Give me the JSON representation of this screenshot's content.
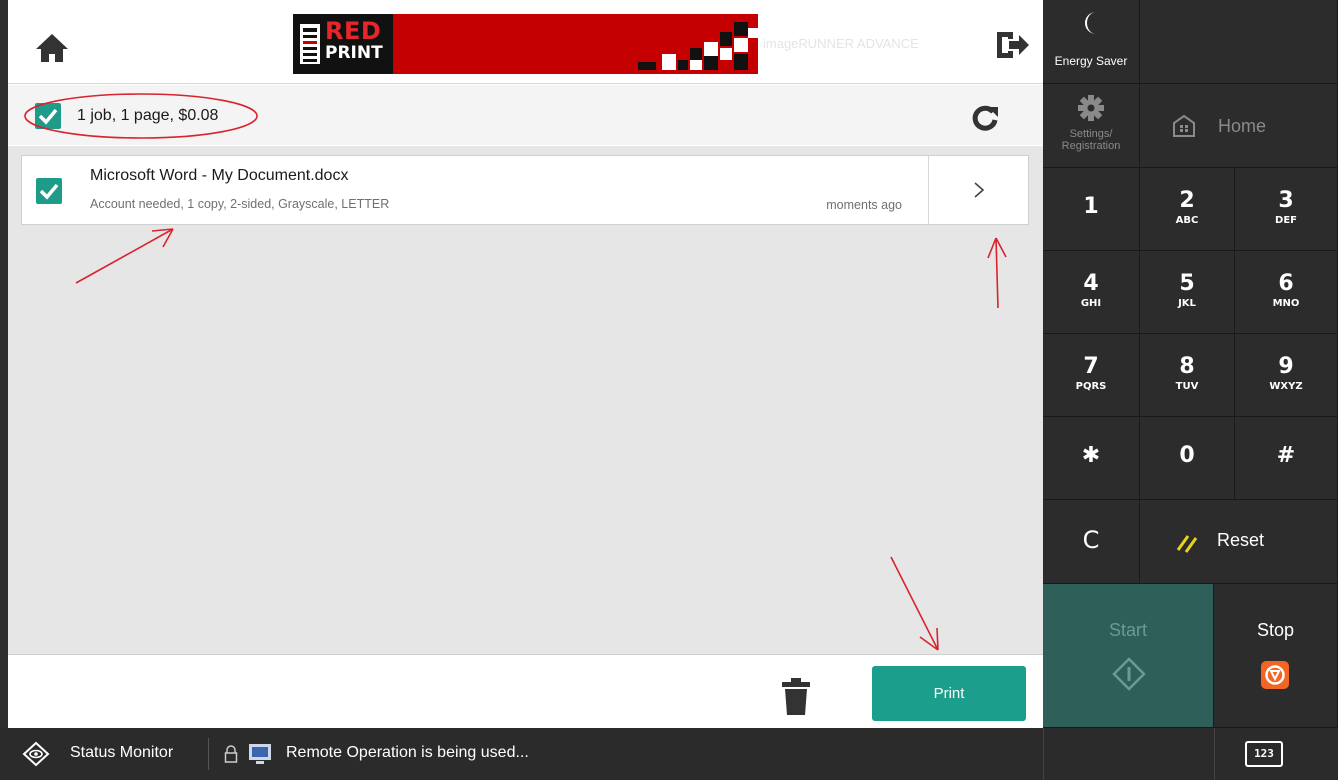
{
  "topbar": {
    "banner_red": "RED",
    "banner_print": "PRINT",
    "banner_faded": "imageRUNNER ADVANCE"
  },
  "summary": {
    "text": "1 job, 1 page, $0.08"
  },
  "job": {
    "title": "Microsoft Word - My Document.docx",
    "details": "Account needed, 1 copy, 2-sided, Grayscale, LETTER",
    "time": "moments ago"
  },
  "footer": {
    "print_label": "Print"
  },
  "statusbar": {
    "status_monitor": "Status Monitor",
    "remote": "Remote Operation is being used...",
    "keypad_toggle": "123"
  },
  "panel": {
    "energy_saver": "Energy Saver",
    "settings": "Settings/ Registration",
    "home": "Home",
    "keys": [
      {
        "num": "1",
        "sub": ""
      },
      {
        "num": "2",
        "sub": "ABC"
      },
      {
        "num": "3",
        "sub": "DEF"
      },
      {
        "num": "4",
        "sub": "GHI"
      },
      {
        "num": "5",
        "sub": "JKL"
      },
      {
        "num": "6",
        "sub": "MNO"
      },
      {
        "num": "7",
        "sub": "PQRS"
      },
      {
        "num": "8",
        "sub": "TUV"
      },
      {
        "num": "9",
        "sub": "WXYZ"
      },
      {
        "num": "✱",
        "sub": ""
      },
      {
        "num": "0",
        "sub": ""
      },
      {
        "num": "#",
        "sub": ""
      }
    ],
    "clear": "C",
    "reset": "Reset",
    "start": "Start",
    "stop": "Stop"
  },
  "colors": {
    "accent": "#1b9e8b",
    "check": "#1e9c89",
    "start_bg": "#2e5f58",
    "stop_icon": "#f26522",
    "annotation": "#d9232e"
  }
}
